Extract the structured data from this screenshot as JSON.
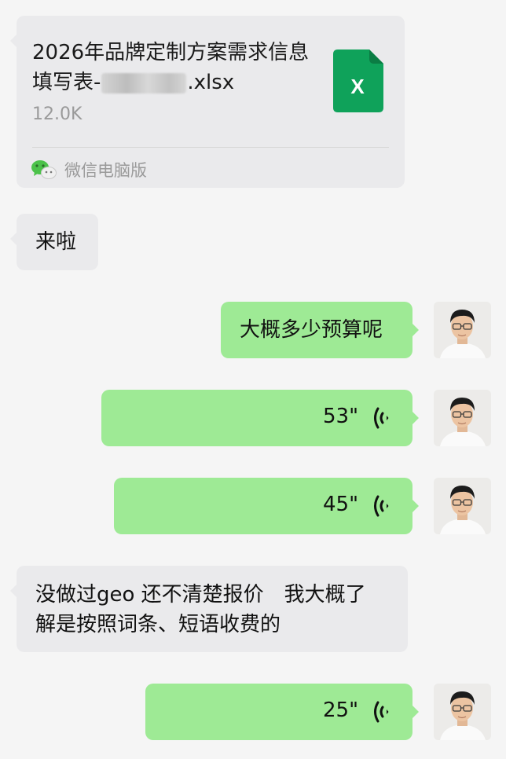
{
  "file_message": {
    "name_prefix": "2026年品牌定制方案需求信息填写表-",
    "name_suffix": ".xlsx",
    "size": "12.0K",
    "source": "微信电脑版",
    "icon": "excel-file-icon",
    "icon_letter": "X",
    "icon_color": "#0fa25a"
  },
  "messages": [
    {
      "side": "left",
      "type": "text",
      "text": "来啦"
    },
    {
      "side": "right",
      "type": "text",
      "text": "大概多少预算呢"
    },
    {
      "side": "right",
      "type": "voice",
      "duration": "53\""
    },
    {
      "side": "right",
      "type": "voice",
      "duration": "45\""
    },
    {
      "side": "left",
      "type": "text",
      "line1": "没做过geo 还不清楚报价　我大概了",
      "line2": "解是按照词条、短语收费的"
    },
    {
      "side": "right",
      "type": "voice",
      "duration": "25\""
    }
  ],
  "colors": {
    "background": "#f5f5f5",
    "incoming_bubble": "#eaeaec",
    "outgoing_bubble": "#9eea95"
  }
}
